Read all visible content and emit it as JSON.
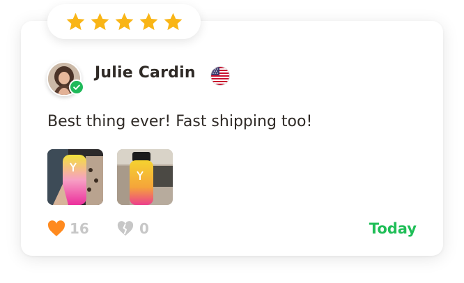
{
  "rating": {
    "stars": 5,
    "max": 5,
    "star_color": "#f9b516"
  },
  "reviewer": {
    "name": "Julie Cardin",
    "verified": true,
    "country_flag": "us-flag-icon"
  },
  "review": {
    "text": "Best thing ever! Fast shipping too!"
  },
  "photos": [
    {
      "name": "photo-1",
      "description": "water bottle"
    },
    {
      "name": "photo-2",
      "description": "water bottle"
    }
  ],
  "reactions": {
    "likes": "16",
    "dislikes": "0",
    "like_icon": "heart-icon",
    "dislike_icon": "broken-heart-icon",
    "like_color": "#ff8a1f"
  },
  "meta": {
    "date": "Today",
    "date_color": "#1fbe57"
  }
}
